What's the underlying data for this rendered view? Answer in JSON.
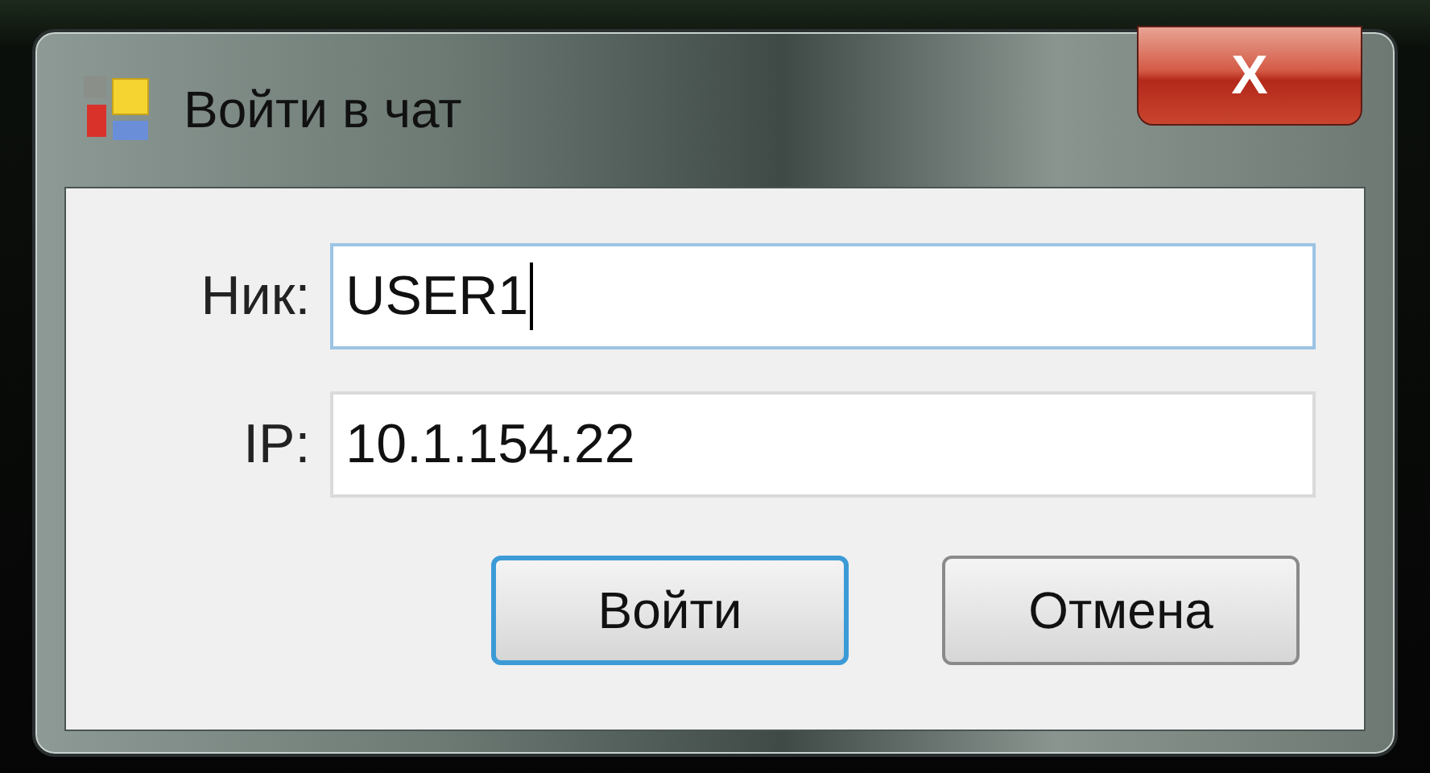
{
  "window": {
    "title": "Войти в чат",
    "close_label": "X"
  },
  "fields": [
    {
      "label": "Ник:",
      "value": "USER1",
      "focused": true
    },
    {
      "label": "IP:",
      "value": "10.1.154.22",
      "focused": false
    }
  ],
  "buttons": [
    {
      "label": "Войти",
      "default": true
    },
    {
      "label": "Отмена",
      "default": false
    }
  ]
}
